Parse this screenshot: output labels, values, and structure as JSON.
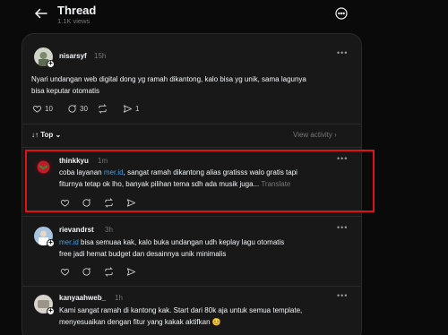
{
  "header": {
    "title": "Thread",
    "views": "1.1K views"
  },
  "sort": {
    "label": "Top",
    "view_activity": "View activity"
  },
  "post": {
    "username": "nisarsyf",
    "time": "15h",
    "text_line1": "Nyari undangan web digital dong yg ramah dikantong, kalo bisa yg unik, sama lagunya",
    "text_line2": "bisa keputar otomatis",
    "likes": "10",
    "comments": "30",
    "shares": "1"
  },
  "replies": [
    {
      "username": "thinkkyu",
      "time": "1m",
      "link": "mer.id",
      "line1_a": "coba layanan ",
      "line1_b": ", sangat ramah dikantong alias gratisss walo gratis tapi",
      "line2": "fiturnya tetap ok lho, banyak pilihan tema sdh ada musik juga... ",
      "translate": "Translate"
    },
    {
      "username": "rievandrst",
      "time": "3h",
      "link": "mer.id",
      "line1_b": " bisa semuaa kak, kalo buka undangan udh keplay lagu otomatis",
      "line2": "free jadi hemat budget dan desainnya unik minimalis"
    },
    {
      "username": "kanyaahweb_",
      "time": "1h",
      "line1": "Kami sangat ramah di kantong kak. Start dari 80k aja untuk semua template,",
      "line2": "menyesuaikan dengan fitur yang kakak aktifkan 😊"
    }
  ],
  "colors": {
    "background": "#0a0a0a",
    "panel": "#181818",
    "link": "#4d9de0",
    "highlight": "#e01212"
  }
}
